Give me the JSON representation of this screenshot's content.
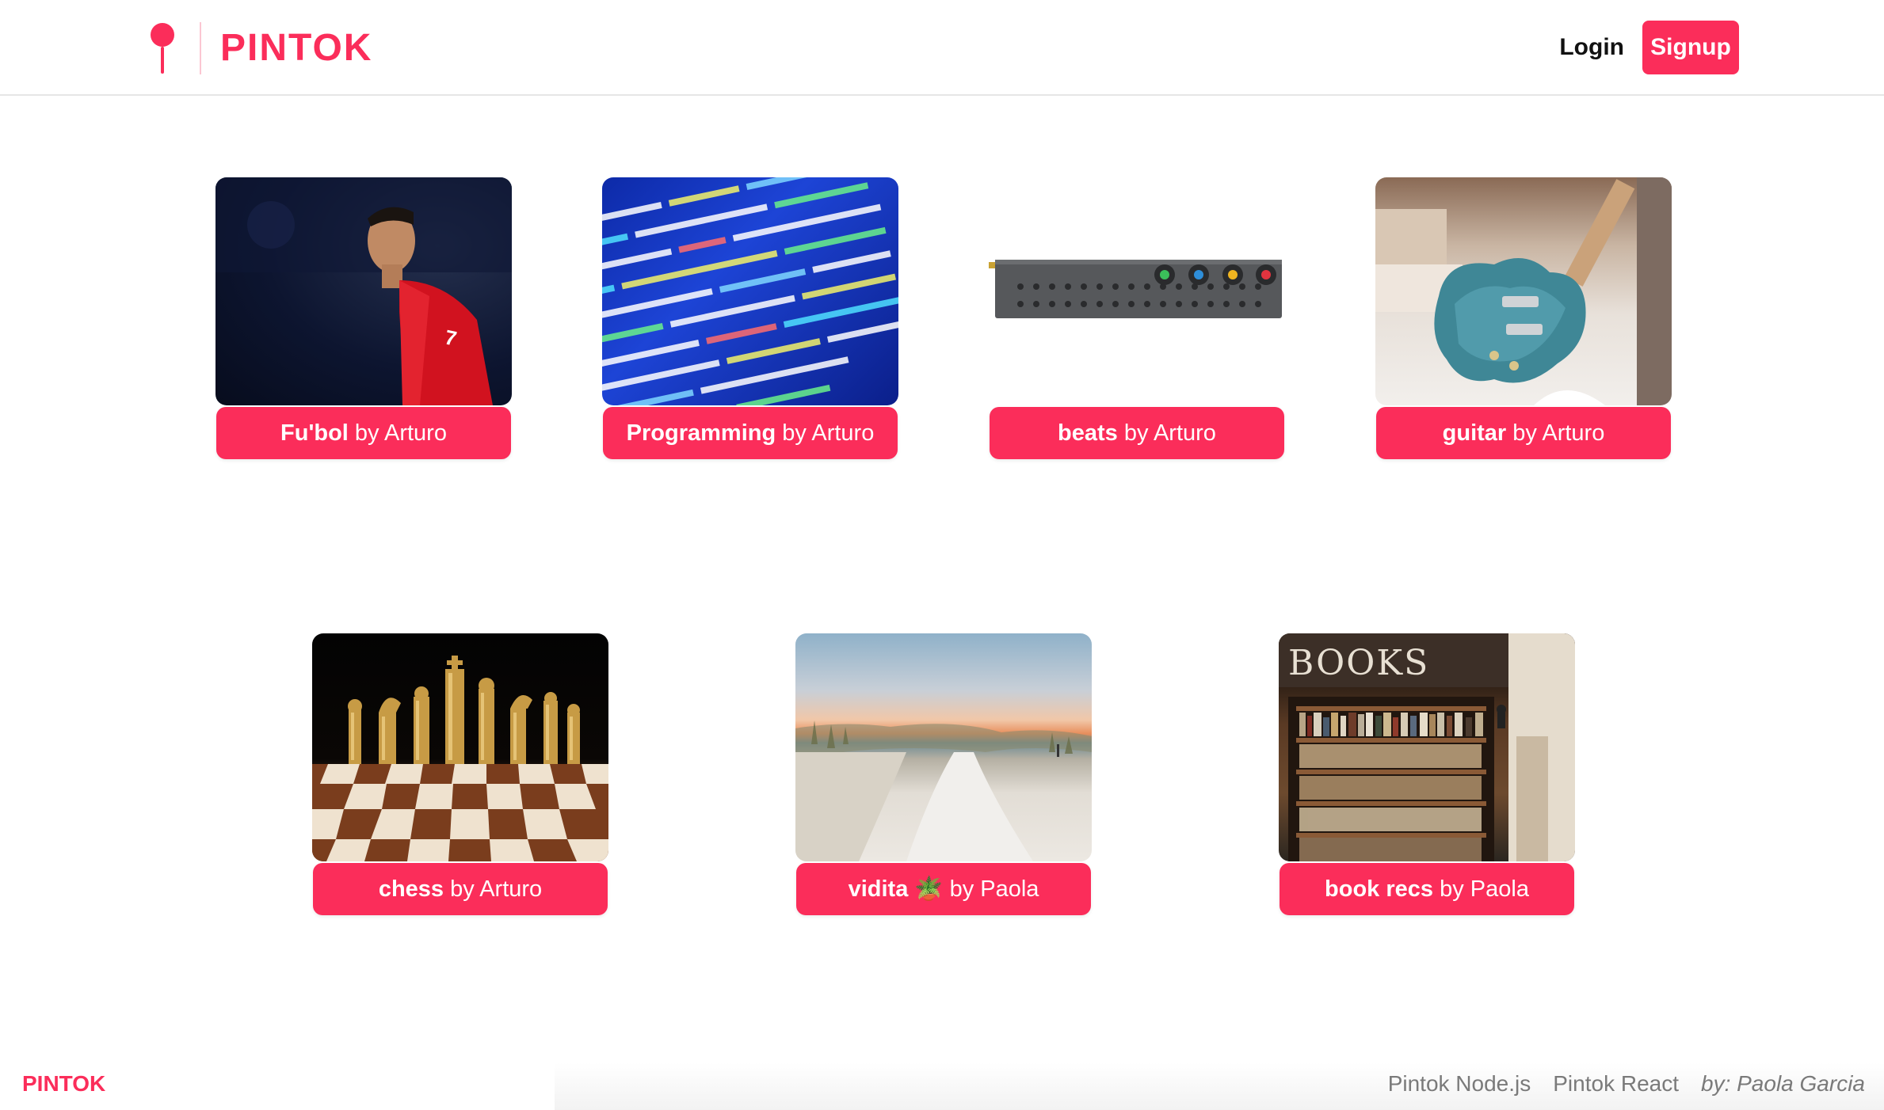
{
  "app": {
    "brand": "PINTOK",
    "accent_color": "#fb2d5a",
    "logo_icon": "pin-icon"
  },
  "nav": {
    "login_label": "Login",
    "signup_label": "Signup"
  },
  "boards": [
    {
      "title": "Fu'bol",
      "by": "by Arturo",
      "image": "soccer-player-photo"
    },
    {
      "title": "Programming",
      "by": "by Arturo",
      "image": "code-screen-photo"
    },
    {
      "title": "beats",
      "by": "by Arturo",
      "image": "synthesizer-photo"
    },
    {
      "title": "guitar",
      "by": "by Arturo",
      "image": "electric-guitar-photo"
    },
    {
      "title": "chess",
      "by": "by Arturo",
      "image": "chess-pieces-photo"
    },
    {
      "title": "vidita 🪴",
      "by": "by Paola",
      "image": "beach-sunset-photo"
    },
    {
      "title": "book recs",
      "by": "by Paola",
      "image": "bookstore-photo"
    }
  ],
  "footer": {
    "brand": "PINTOK",
    "links": [
      "Pintok Node.js",
      "Pintok React"
    ],
    "credit": "by: Paola Garcia"
  }
}
